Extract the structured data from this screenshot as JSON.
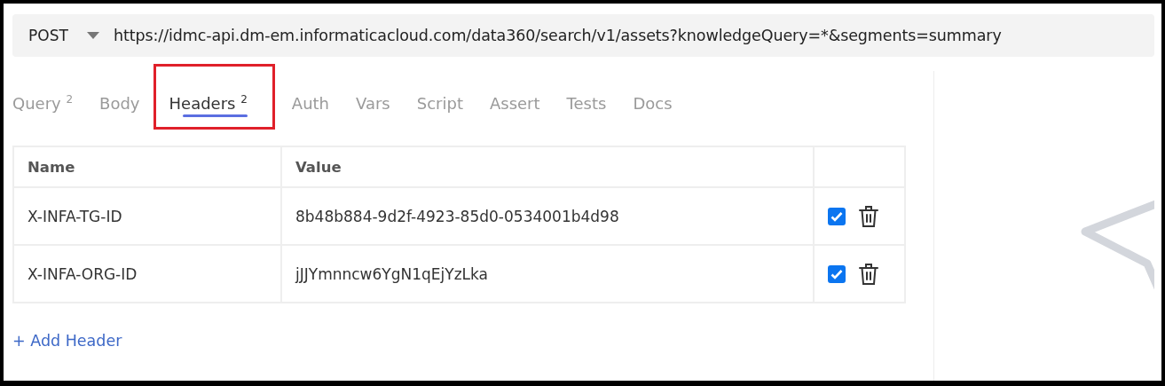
{
  "request": {
    "method": "POST",
    "url": "https://idmc-api.dm-em.informaticacloud.com/data360/search/v1/assets?knowledgeQuery=*&segments=summary"
  },
  "tabs": [
    {
      "label": "Query",
      "count": "2",
      "selected": false
    },
    {
      "label": "Body",
      "selected": false
    },
    {
      "label": "Headers",
      "count": "2",
      "selected": true
    },
    {
      "label": "Auth",
      "selected": false
    },
    {
      "label": "Vars",
      "selected": false
    },
    {
      "label": "Script",
      "selected": false
    },
    {
      "label": "Assert",
      "selected": false
    },
    {
      "label": "Tests",
      "selected": false
    },
    {
      "label": "Docs",
      "selected": false
    }
  ],
  "table": {
    "columns": [
      "Name",
      "Value"
    ],
    "rows": [
      {
        "name": "X-INFA-TG-ID",
        "value": "8b48b884-9d2f-4923-85d0-0534001b4d98",
        "checked": true
      },
      {
        "name": "X-INFA-ORG-ID",
        "value": "jJJYmnncw6YgN1qEjYzLka",
        "checked": true
      }
    ]
  },
  "add_link": "+ Add Header"
}
